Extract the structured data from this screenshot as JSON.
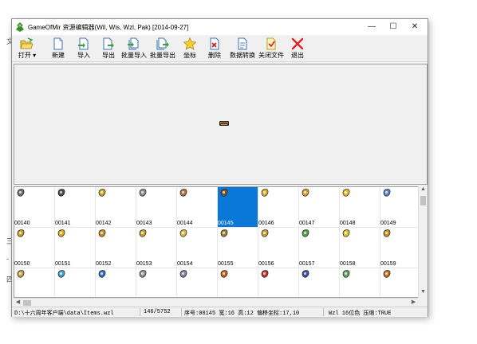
{
  "window": {
    "title": "GameOfMir 资源编辑器(Wil, Wis, Wzl, Pak) [2014-09-27]",
    "controls": {
      "minimize": "—",
      "maximize": "☐",
      "close": "✕"
    }
  },
  "background": {
    "fragments": [
      "文",
      "三",
      "-",
      "四"
    ]
  },
  "toolbar": {
    "buttons": [
      {
        "label": "打开",
        "icon": "open-folder-icon",
        "dropdown": "▾"
      },
      {
        "label": "新建",
        "icon": "new-file-icon"
      },
      {
        "label": "导入",
        "icon": "import-icon"
      },
      {
        "label": "导出",
        "icon": "export-icon"
      },
      {
        "label": "批量导入",
        "icon": "batch-import-icon"
      },
      {
        "label": "批量导出",
        "icon": "batch-export-icon"
      },
      {
        "label": "坐标",
        "icon": "star-icon"
      },
      {
        "label": "删除",
        "icon": "delete-icon"
      },
      {
        "label": "数据转换",
        "icon": "convert-icon"
      },
      {
        "label": "关闭文件",
        "icon": "close-file-icon"
      },
      {
        "label": "退出",
        "icon": "exit-icon"
      }
    ]
  },
  "grid": {
    "cells": [
      {
        "id": "00140",
        "color": "#6b6b6b"
      },
      {
        "id": "00141",
        "color": "#4a4a4a"
      },
      {
        "id": "00142",
        "color": "#c9a227"
      },
      {
        "id": "00143",
        "color": "#8a8a8a"
      },
      {
        "id": "00144",
        "color": "#b07040"
      },
      {
        "id": "00145",
        "color": "#7a5530"
      },
      {
        "id": "00146",
        "color": "#d4b020"
      },
      {
        "id": "00147",
        "color": "#d4a020"
      },
      {
        "id": "00148",
        "color": "#e0c020"
      },
      {
        "id": "00149",
        "color": "#6080c0"
      },
      {
        "id": "00150",
        "color": "#c8a020"
      },
      {
        "id": "00151",
        "color": "#d4b020"
      },
      {
        "id": "00152",
        "color": "#c09020"
      },
      {
        "id": "00153",
        "color": "#c8a030"
      },
      {
        "id": "00154",
        "color": "#d8b840"
      },
      {
        "id": "00155",
        "color": "#a08030"
      },
      {
        "id": "00156",
        "color": "#c8a030"
      },
      {
        "id": "00157",
        "color": "#50a050"
      },
      {
        "id": "00158",
        "color": "#e0c020"
      },
      {
        "id": "00159",
        "color": "#c89020"
      },
      {
        "id": "",
        "color": "#c0a040"
      },
      {
        "id": "",
        "color": "#40a0c0"
      },
      {
        "id": "",
        "color": "#3070c0"
      },
      {
        "id": "",
        "color": "#909090"
      },
      {
        "id": "",
        "color": "#8080a0"
      },
      {
        "id": "",
        "color": "#c06020"
      },
      {
        "id": "",
        "color": "#c03030"
      },
      {
        "id": "",
        "color": "#4050a0"
      },
      {
        "id": "",
        "color": "#60a060"
      },
      {
        "id": "",
        "color": "#c07020"
      }
    ],
    "selected_id": "00145"
  },
  "scrollbars": {
    "up": "▲",
    "down": "▼",
    "left": "◀",
    "right": "▶"
  },
  "status": {
    "path": "D:\\十六周年客户端\\data\\Items.wzl",
    "count": "146/5752",
    "details": "序号:00145 宽:16 高:12 偏移坐标:17,10",
    "format": "Wzl 16位色 压缩:TRUE"
  }
}
